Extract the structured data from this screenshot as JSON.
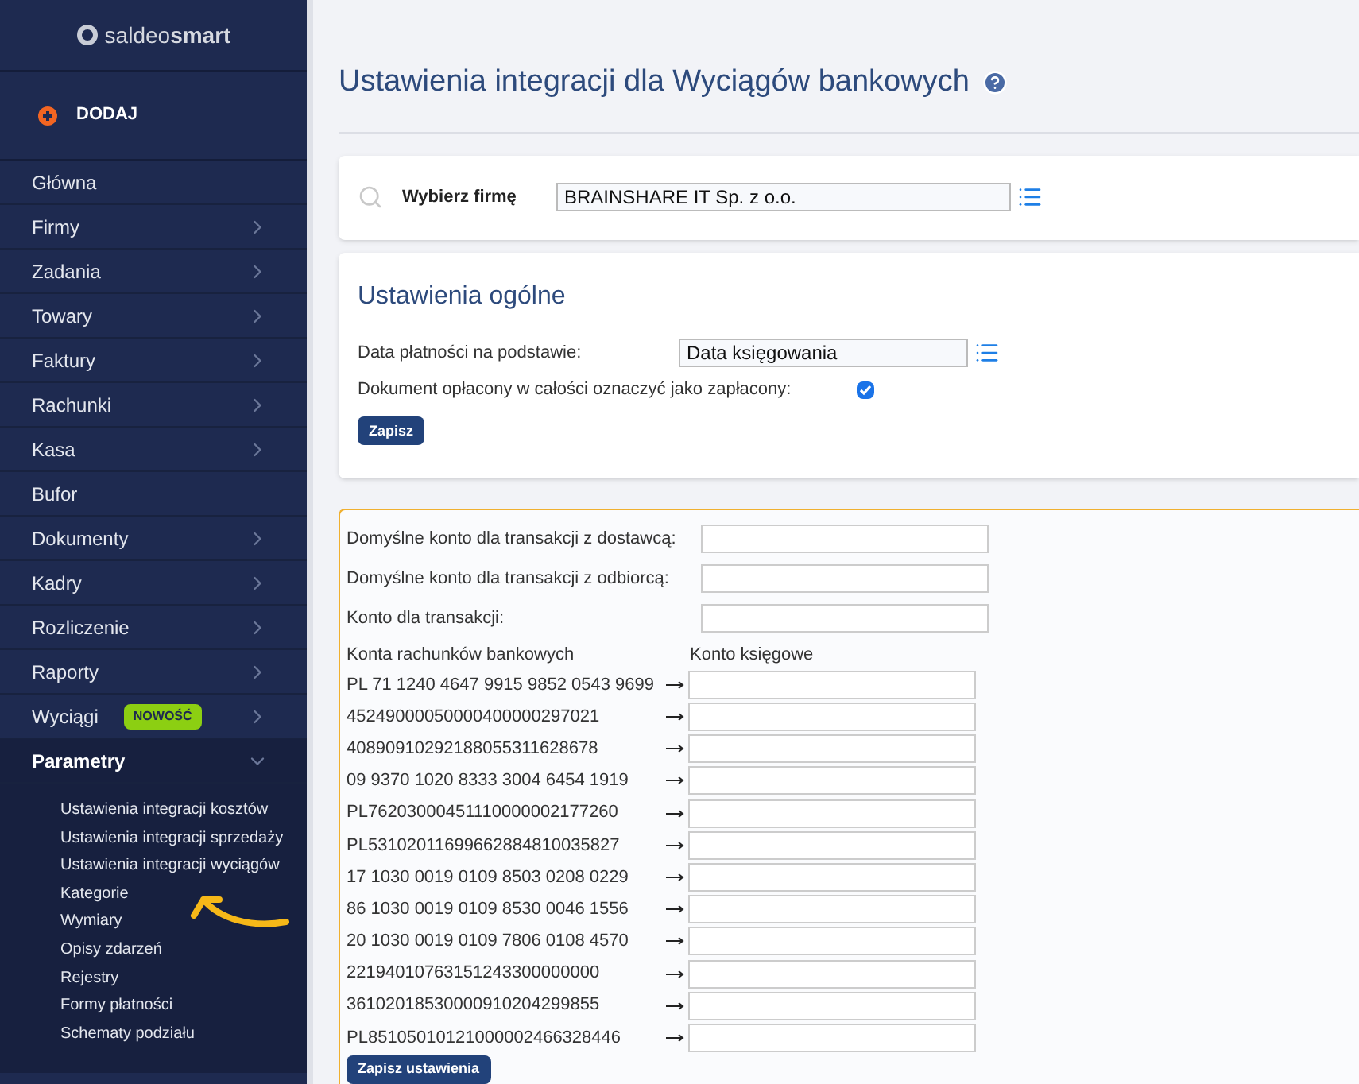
{
  "sidebar": {
    "logo": {
      "light": "saldeo",
      "bold": "smart"
    },
    "add_button": "DODAJ",
    "items": [
      {
        "label": "Główna",
        "has_submenu": false,
        "expanded": false
      },
      {
        "label": "Firmy",
        "has_submenu": true,
        "expanded": false
      },
      {
        "label": "Zadania",
        "has_submenu": true,
        "expanded": false
      },
      {
        "label": "Towary",
        "has_submenu": true,
        "expanded": false
      },
      {
        "label": "Faktury",
        "has_submenu": true,
        "expanded": false
      },
      {
        "label": "Rachunki",
        "has_submenu": true,
        "expanded": false
      },
      {
        "label": "Kasa",
        "has_submenu": true,
        "expanded": false
      },
      {
        "label": "Bufor",
        "has_submenu": false,
        "expanded": false
      },
      {
        "label": "Dokumenty",
        "has_submenu": true,
        "expanded": false
      },
      {
        "label": "Kadry",
        "has_submenu": true,
        "expanded": false
      },
      {
        "label": "Rozliczenie",
        "has_submenu": true,
        "expanded": false
      },
      {
        "label": "Raporty",
        "has_submenu": true,
        "expanded": false
      },
      {
        "label": "Wyciągi",
        "badge": "NOWOŚĆ",
        "has_submenu": true,
        "expanded": false
      },
      {
        "label": "Parametry",
        "has_submenu": true,
        "expanded": true,
        "children": [
          "Ustawienia integracji kosztów",
          "Ustawienia integracji sprzedaży",
          "Ustawienia integracji wyciągów",
          "Kategorie",
          "Wymiary",
          "Opisy zdarzeń",
          "Rejestry",
          "Formy płatności",
          "Schematy podziału"
        ]
      }
    ]
  },
  "page_title": "Ustawienia integracji dla Wyciągów bankowych",
  "company": {
    "label": "Wybierz firmę",
    "value": "BRAINSHARE IT Sp. z o.o."
  },
  "general": {
    "title": "Ustawienia ogólne",
    "date_label": "Data płatności na podstawie:",
    "date_value": "Data księgowania",
    "paid_label": "Dokument opłacony w całości oznaczyć jako zapłacony:",
    "paid_checked": true,
    "save": "Zapisz"
  },
  "accounts": {
    "fields": [
      "Domyślne konto dla transakcji z dostawcą:",
      "Domyślne konto dla transakcji z odbiorcą:",
      "Konto dla transakcji:"
    ],
    "columns": [
      "Konta rachunków bankowych",
      "Konto księgowe"
    ],
    "rows": [
      "PL 71 1240 4647 9915 9852 0543 9699",
      "45249000050000400000297021",
      "40890910292188055311628678",
      "09 9370 1020 8333 3004 6454 1919",
      "PL76203000451110000002177260",
      "PL53102011699662884810035827",
      "17 1030 0019 0109 8503 0208 0229",
      "86 1030 0019 0109 8530 0046 1556",
      "20 1030 0019 0109 7806 0108 4570",
      "22194010763151243300000000",
      "36102018530000910204299855",
      "PL85105010121000002466328446"
    ],
    "save": "Zapisz ustawienia"
  }
}
